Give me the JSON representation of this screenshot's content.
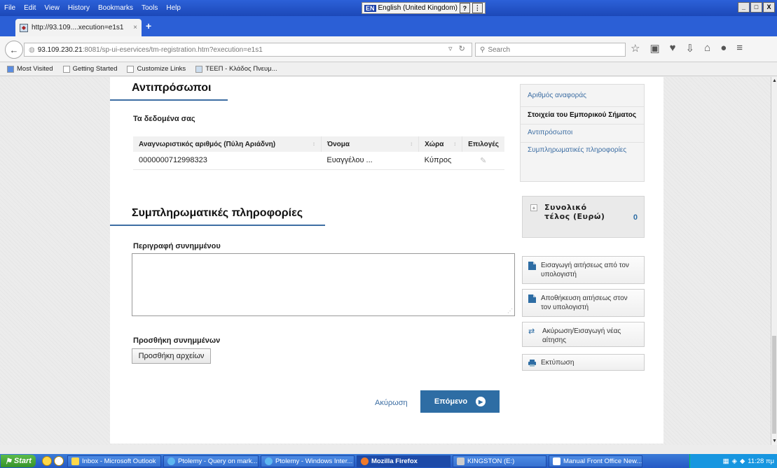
{
  "menu": [
    "File",
    "Edit",
    "View",
    "History",
    "Bookmarks",
    "Tools",
    "Help"
  ],
  "language": {
    "code": "EN",
    "label": "English (United Kingdom)"
  },
  "window_controls": [
    "_",
    "□",
    "X"
  ],
  "tab": {
    "title": "http://93.109....xecution=e1s1",
    "close": "×"
  },
  "newtab": "+",
  "url": {
    "host": "93.109.230.21",
    "path": ":8081/sp-ui-eservices/tm-registration.htm?execution=e1s1"
  },
  "search": {
    "placeholder": "Search"
  },
  "bookmarks": [
    "Most Visited",
    "Getting Started",
    "Customize Links",
    "ΤΕΕΠ - Κλάδος Πνευμ..."
  ],
  "reps": {
    "title": "Αντιπρόσωποι",
    "subtitle": "Τα δεδομένα σας",
    "columns": [
      "Αναγνωριστικός αριθμός (Πύλη Αριάδνη)",
      "Όνομα",
      "Χώρα",
      "Επιλογές"
    ],
    "rows": [
      {
        "id": "0000000712998323",
        "name": "Ευαγγέλου ...",
        "country": "Κύπρος"
      }
    ]
  },
  "extra": {
    "title": "Συμπληρωματικές πληροφορίες",
    "desc_label": "Περιγραφή συνημμένου",
    "attach_label": "Προσθήκη συνημμένων",
    "add_files": "Προσθήκη αρχείων"
  },
  "actions": {
    "cancel": "Ακύρωση",
    "next": "Επόμενο"
  },
  "sidenav": [
    "Αριθμός αναφοράς",
    "Στοιχεία του Εμπορικού Σήματος",
    "Αντιπρόσωποι",
    "Συμπληρωματικές πληροφορίες"
  ],
  "fee": {
    "label": "Συνολικό τέλος (Ευρώ)",
    "value": "0"
  },
  "side_actions": [
    "Εισαγωγή αιτήσεως από τον υπολογιστή",
    "Αποθήκευση αιτήσεως στον τον υπολογιστή",
    "Ακύρωση/Εισαγωγή νέας αίτησης",
    "Εκτύπωση"
  ],
  "taskbar": {
    "start": "Start",
    "tasks": [
      "Inbox - Microsoft Outlook",
      "Ptolemy - Query on mark...",
      "Ptolemy - Windows Inter...",
      "Mozilla Firefox",
      "KINGSTON (E:)",
      "Manual Front Office New..."
    ],
    "clock": "11:28 πμ"
  },
  "colors": {
    "accent": "#2e6da4",
    "link": "#3d6ea3",
    "titlebar": "#2c61d8"
  }
}
